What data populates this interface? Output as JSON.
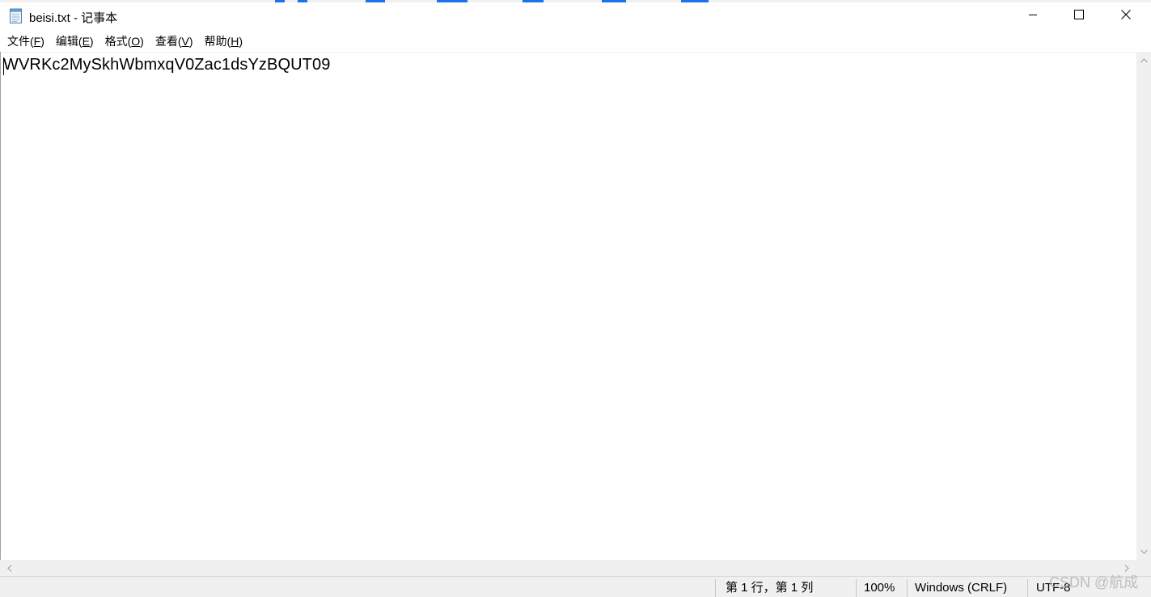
{
  "window": {
    "title": "beisi.txt - 记事本",
    "app_icon": "notepad-icon"
  },
  "controls": {
    "minimize_icon": "minimize-icon",
    "maximize_icon": "maximize-icon",
    "close_icon": "close-icon"
  },
  "menu": {
    "items": [
      {
        "label": "文件(",
        "accel": "F",
        "suffix": ")"
      },
      {
        "label": "编辑(",
        "accel": "E",
        "suffix": ")"
      },
      {
        "label": "格式(",
        "accel": "O",
        "suffix": ")"
      },
      {
        "label": "查看(",
        "accel": "V",
        "suffix": ")"
      },
      {
        "label": "帮助(",
        "accel": "H",
        "suffix": ")"
      }
    ]
  },
  "editor": {
    "content": "WVRKc2MySkhWbmxqV0Zac1dsYzBQUT09"
  },
  "status": {
    "position": "第 1 行，第 1 列",
    "zoom": "100%",
    "line_ending": "Windows (CRLF)",
    "encoding": "UTF-8"
  },
  "watermark": {
    "text": "CSDN @航成"
  },
  "colors": {
    "chrome": "#f0f0f0",
    "editor_bg": "#ffffff",
    "text": "#000000",
    "accent": "#1a73e8"
  }
}
